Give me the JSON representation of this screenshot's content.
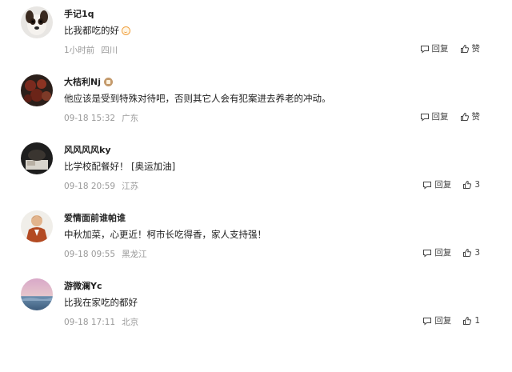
{
  "comments": [
    {
      "user": "手记1q",
      "text": "比我都吃的好",
      "has_emoji": true,
      "time": "1小时前",
      "location": "四川",
      "reply_label": "回复",
      "like_label": "赞"
    },
    {
      "user": "大桔利Nj",
      "has_badge": true,
      "text": "他应该是受到特殊对待吧，否则其它人会有犯案进去养老的冲动。",
      "time": "09-18 15:32",
      "location": "广东",
      "reply_label": "回复",
      "like_label": "赞"
    },
    {
      "user": "风风风风ky",
      "text": "比学校配餐好！ [奥运加油]",
      "time": "09-18 20:59",
      "location": "江苏",
      "reply_label": "回复",
      "like_label": "3"
    },
    {
      "user": "爱情面前谁帕谁",
      "text": "中秋加菜，心更近！柯市长吃得香，家人支持强！",
      "time": "09-18 09:55",
      "location": "黑龙江",
      "reply_label": "回复",
      "like_label": "3"
    },
    {
      "user": "游微澜Yc",
      "text": "比我在家吃的都好",
      "time": "09-18 17:11",
      "location": "北京",
      "reply_label": "回复",
      "like_label": "1"
    }
  ],
  "icons": {
    "reply": "comment-bubble-icon",
    "like": "thumbs-up-icon"
  }
}
